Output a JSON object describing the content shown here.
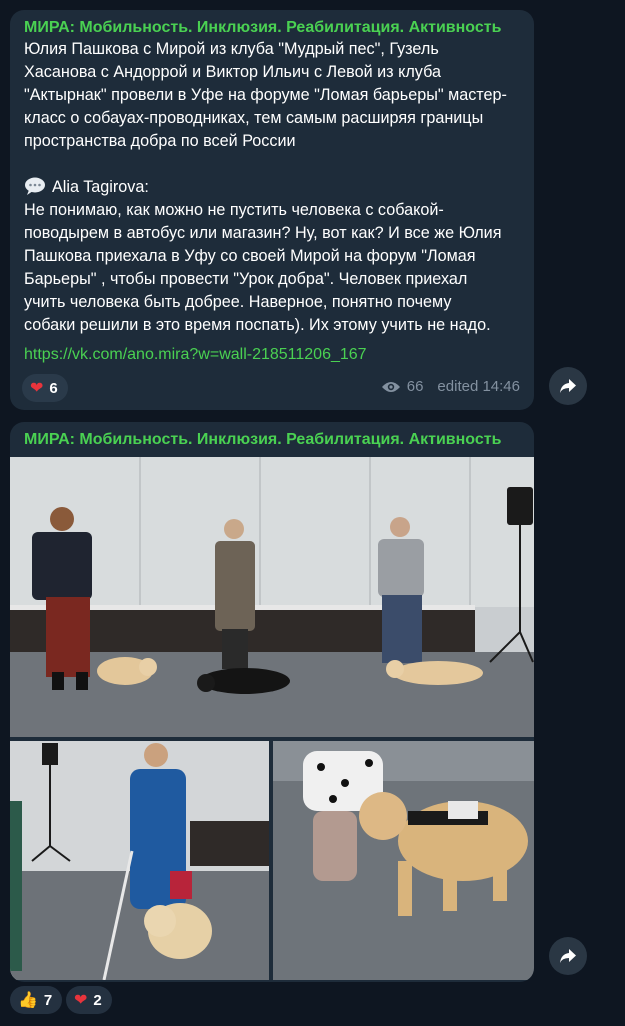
{
  "post1": {
    "channel": "МИРА: Мобильность. Инклюзия. Реабилитация. Активность",
    "paragraph1": [
      "Юлия Пашкова с Мирой из клуба \"Мудрый пес\",  Гузель",
      "Хасанова с Андоррой и Виктор Ильич с Левой из клуба",
      "\"Актырнак\" провели в Уфе на форуме \"Ломая барьеры\" мастер-",
      "класс о собауах-проводниках, тем самым расширяя границы",
      "пространства добра по всей России"
    ],
    "quote_author": "Alia Tagirova:",
    "paragraph2": [
      "Не понимаю, как можно не пустить человека с собакой-",
      "поводырем в автобус или магазин? Ну, вот как? И все же Юлия",
      "Пашкова приехала в Уфу со своей Мирой на форум \"Ломая",
      "Барьеры\" , чтобы провести \"Урок добра\". Человек приехал",
      "учить человека быть добрее. Наверное, понятно почему",
      "собаки  решили в это время поспать). Их этому учить не надо."
    ],
    "link": "https://vk.com/ano.mira?w=wall-218511206_167",
    "reaction_emoji": "❤",
    "reaction_count": "6",
    "views": "66",
    "edited": "edited 14:46"
  },
  "post2": {
    "channel": "МИРА: Мобильность. Инклюзия. Реабилитация. Активность",
    "photos": [
      "photo-group-with-dogs",
      "photo-woman-with-cane-and-dog",
      "photo-woman-petting-dog"
    ]
  },
  "bottom_reactions": [
    {
      "emoji": "👍",
      "count": "7"
    },
    {
      "emoji": "❤",
      "count": "2"
    }
  ],
  "colors": {
    "background": "#0e1621",
    "bubble": "#1e2c3a",
    "accent_green": "#4ad152",
    "meta_gray": "#8391a0"
  }
}
